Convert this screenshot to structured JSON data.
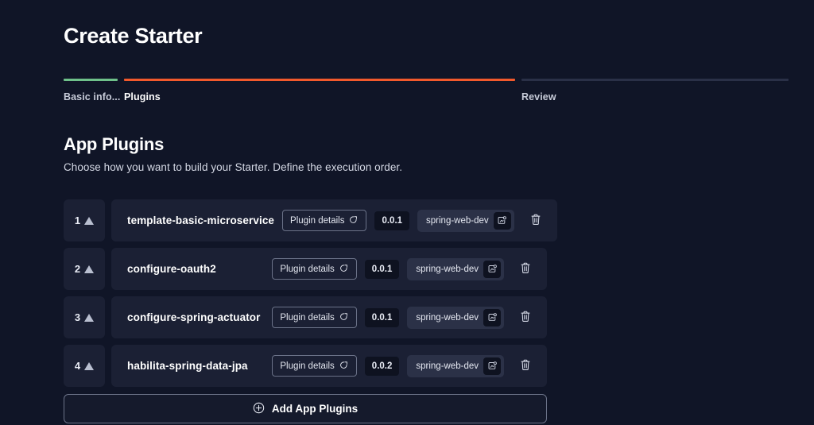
{
  "page_title": "Create Starter",
  "stepper": {
    "steps": [
      {
        "label": "Basic info...",
        "state": "completed",
        "color": "#6fc18a"
      },
      {
        "label": "Plugins",
        "state": "active",
        "color": "#f2592c"
      },
      {
        "label": "Review",
        "state": "inactive",
        "color": "#2a3047"
      }
    ]
  },
  "section": {
    "title": "App Plugins",
    "subtitle": "Choose how you want to build your Starter. Define the execution order."
  },
  "plugins": {
    "details_label": "Plugin details",
    "details_icon": "external-link-icon",
    "move_up_icon": "arrow-up-icon",
    "configure_icon": "configure-icon",
    "delete_icon": "trash-icon",
    "rows": [
      {
        "order": "1",
        "name": "template-basic-microservice",
        "version": "0.0.1",
        "tag": "spring-web-dev"
      },
      {
        "order": "2",
        "name": "configure-oauth2",
        "version": "0.0.1",
        "tag": "spring-web-dev"
      },
      {
        "order": "3",
        "name": "configure-spring-actuator",
        "version": "0.0.1",
        "tag": "spring-web-dev"
      },
      {
        "order": "4",
        "name": "habilita-spring-data-jpa",
        "version": "0.0.2",
        "tag": "spring-web-dev"
      }
    ]
  },
  "add_button": {
    "label": "Add App Plugins",
    "icon": "plus-circle-icon"
  }
}
